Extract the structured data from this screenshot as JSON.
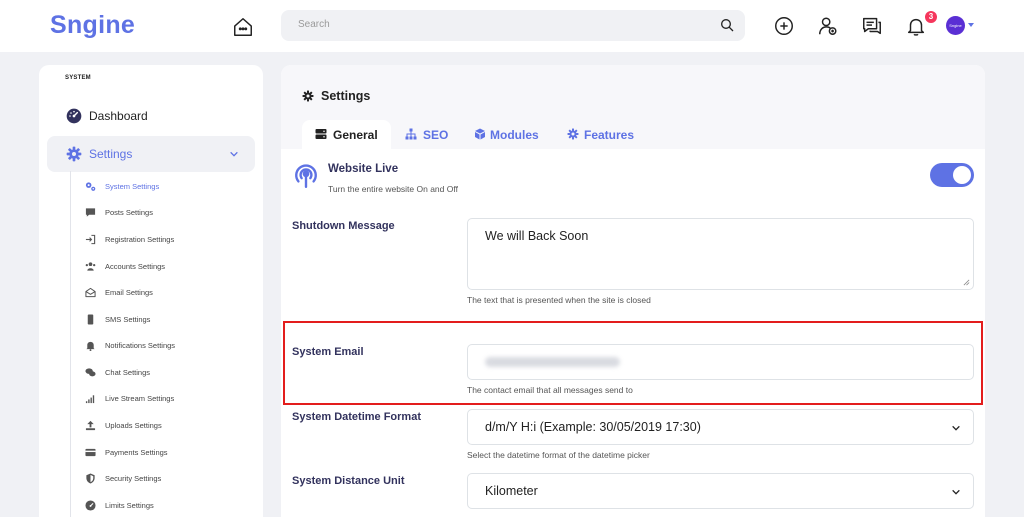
{
  "header": {
    "logo": "Sngine",
    "search_placeholder": "Search",
    "notification_count": "3",
    "avatar_text": "Sngine",
    "icons": [
      "home-icon",
      "search-icon",
      "create-icon",
      "friend-requests-icon",
      "messages-icon",
      "notifications-icon"
    ]
  },
  "sidebar": {
    "section_label": "SYSTEM",
    "dashboard_label": "Dashboard",
    "settings_label": "Settings",
    "sub_items": [
      {
        "label": "System Settings",
        "icon": "gears-icon",
        "active": true
      },
      {
        "label": "Posts Settings",
        "icon": "comment-icon"
      },
      {
        "label": "Registration Settings",
        "icon": "sign-in-icon"
      },
      {
        "label": "Accounts Settings",
        "icon": "users-icon"
      },
      {
        "label": "Email Settings",
        "icon": "envelope-open-icon"
      },
      {
        "label": "SMS Settings",
        "icon": "mobile-icon"
      },
      {
        "label": "Notifications Settings",
        "icon": "bell-icon"
      },
      {
        "label": "Chat Settings",
        "icon": "comments-icon"
      },
      {
        "label": "Live Stream Settings",
        "icon": "signal-icon"
      },
      {
        "label": "Uploads Settings",
        "icon": "upload-icon"
      },
      {
        "label": "Payments Settings",
        "icon": "credit-card-icon"
      },
      {
        "label": "Security Settings",
        "icon": "shield-icon"
      },
      {
        "label": "Limits Settings",
        "icon": "gauge-icon"
      }
    ]
  },
  "main": {
    "title": "Settings",
    "tabs": [
      {
        "label": "General",
        "icon": "server-icon",
        "active": true
      },
      {
        "label": "SEO",
        "icon": "sitemap-icon"
      },
      {
        "label": "Modules",
        "icon": "cube-icon"
      },
      {
        "label": "Features",
        "icon": "cog-icon"
      }
    ],
    "website_live": {
      "title": "Website Live",
      "description": "Turn the entire website On and Off",
      "enabled": true
    },
    "shutdown_message": {
      "label": "Shutdown Message",
      "value": "We will Back Soon",
      "help": "The text that is presented when the site is closed"
    },
    "system_email": {
      "label": "System Email",
      "value_blurred": true,
      "help": "The contact email that all messages send to"
    },
    "datetime_format": {
      "label": "System Datetime Format",
      "value": "d/m/Y H:i (Example: 30/05/2019 17:30)",
      "help": "Select the datetime format of the datetime picker"
    },
    "distance_unit": {
      "label": "System Distance Unit",
      "value": "Kilometer"
    }
  },
  "colors": {
    "accent": "#5e72e4",
    "highlight": "#e31d1d",
    "badge": "#f5365c"
  }
}
